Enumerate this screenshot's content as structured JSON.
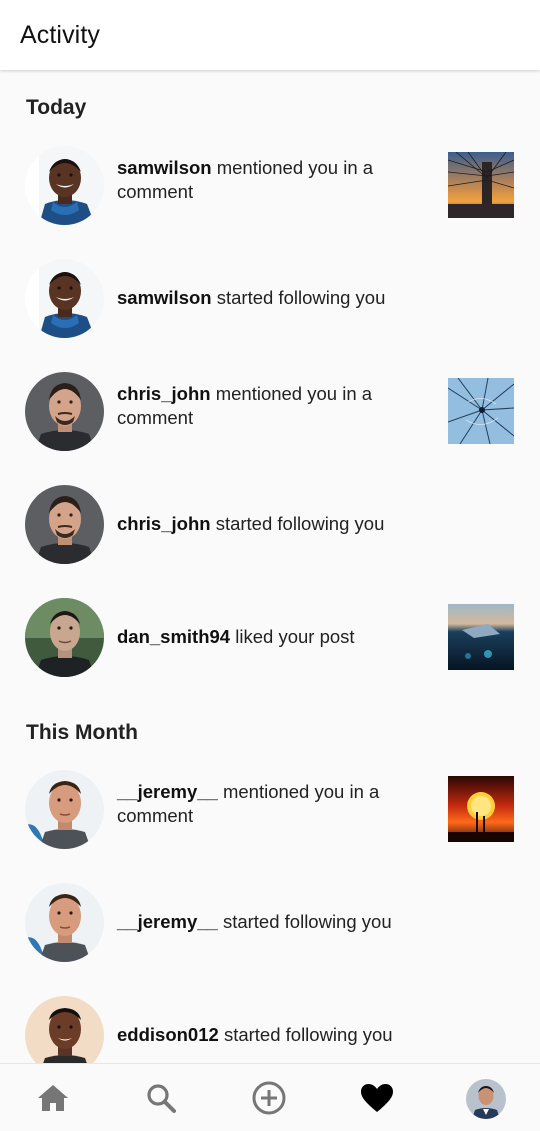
{
  "app": {
    "title": "Activity"
  },
  "sections": [
    {
      "title": "Today"
    },
    {
      "title": "This Month"
    }
  ],
  "items": [
    {
      "user": "samwilson",
      "action": "mentioned you in a comment",
      "avatar": "avatar-samwilson",
      "has_thumb": true,
      "thumb": "bridge-sunset-photo"
    },
    {
      "user": "samwilson",
      "action": "started following you",
      "avatar": "avatar-samwilson",
      "has_thumb": false
    },
    {
      "user": "chris_john",
      "action": "mentioned you in a comment",
      "avatar": "avatar-chris-john",
      "has_thumb": true,
      "thumb": "cracked-glass-photo"
    },
    {
      "user": "chris_john",
      "action": "started following you",
      "avatar": "avatar-chris-john",
      "has_thumb": false
    },
    {
      "user": "dan_smith94",
      "action": "liked your post",
      "avatar": "avatar-dan-smith94",
      "has_thumb": true,
      "thumb": "underwater-photo"
    },
    {
      "user": "__jeremy__",
      "action": "mentioned you in a comment",
      "avatar": "avatar-jeremy",
      "has_thumb": true,
      "thumb": "orange-sunset-photo"
    },
    {
      "user": "__jeremy__",
      "action": "started following you",
      "avatar": "avatar-jeremy",
      "has_thumb": false
    },
    {
      "user": "eddison012",
      "action": "started following you",
      "avatar": "avatar-eddison012",
      "has_thumb": false
    }
  ],
  "bottom_nav": {
    "items": [
      {
        "icon": "home-icon",
        "active": false
      },
      {
        "icon": "search-icon",
        "active": false
      },
      {
        "icon": "add-circle-icon",
        "active": false
      },
      {
        "icon": "heart-icon",
        "active": true
      },
      {
        "icon": "profile-avatar",
        "active": false
      }
    ]
  },
  "colors": {
    "background": "#fafafa",
    "appbar": "#ffffff",
    "text": "#222222",
    "icon_inactive": "#777777",
    "icon_active": "#000000"
  }
}
